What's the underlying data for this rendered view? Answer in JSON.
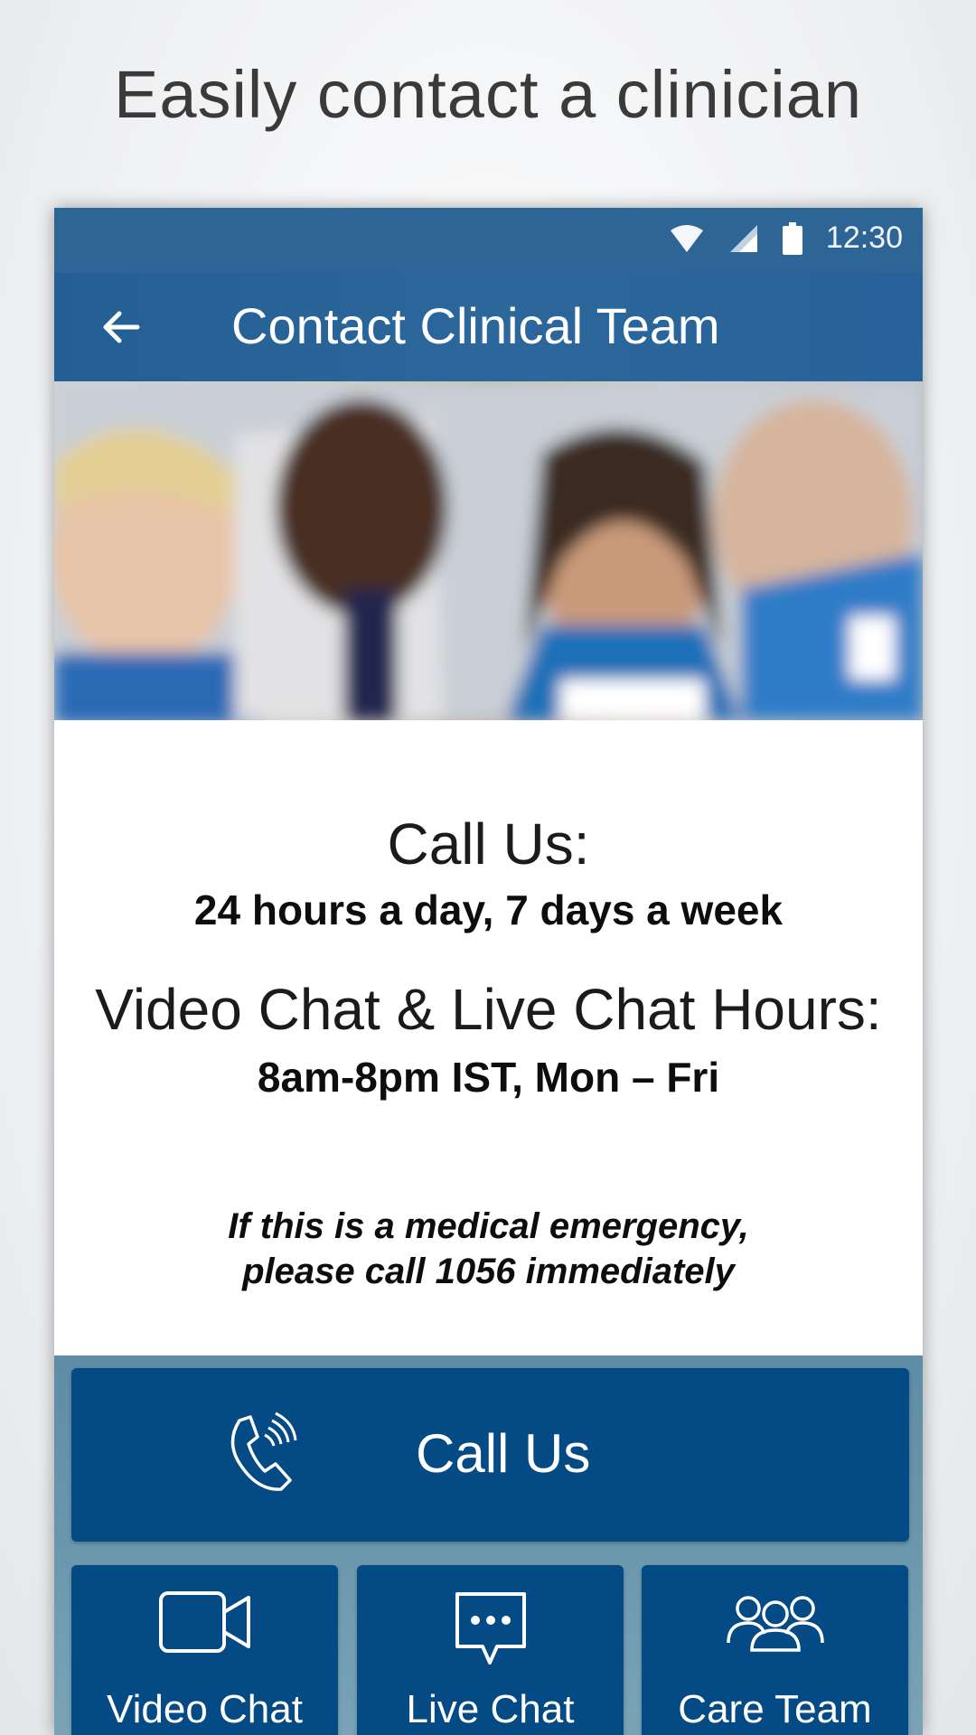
{
  "headline": "Easily contact a clinician",
  "status_bar": {
    "time": "12:30",
    "icons": [
      "wifi-icon",
      "signal-icon",
      "battery-icon"
    ]
  },
  "app_bar": {
    "title": "Contact Clinical Team",
    "back_icon": "arrow-left-icon"
  },
  "hero_image": {
    "alt": "Clinical team photo"
  },
  "content": {
    "call_title": "Call Us:",
    "call_hours": "24 hours a day, 7 days a week",
    "video_title": "Video Chat & Live Chat Hours:",
    "video_hours": "8am-8pm IST, Mon – Fri",
    "emergency_line1": "If this is a medical emergency,",
    "emergency_line2": "please call 1056 immediately"
  },
  "actions": {
    "call": {
      "label": "Call Us",
      "icon": "phone-icon"
    },
    "video": {
      "label": "Video Chat",
      "icon": "video-camera-icon"
    },
    "live": {
      "label": "Live Chat",
      "icon": "chat-bubble-icon"
    },
    "care": {
      "label": "Care Team",
      "icon": "people-group-icon"
    }
  },
  "colors": {
    "app_bar": "#2c679b",
    "button": "#044a84",
    "action_area": "#6b97ad"
  }
}
